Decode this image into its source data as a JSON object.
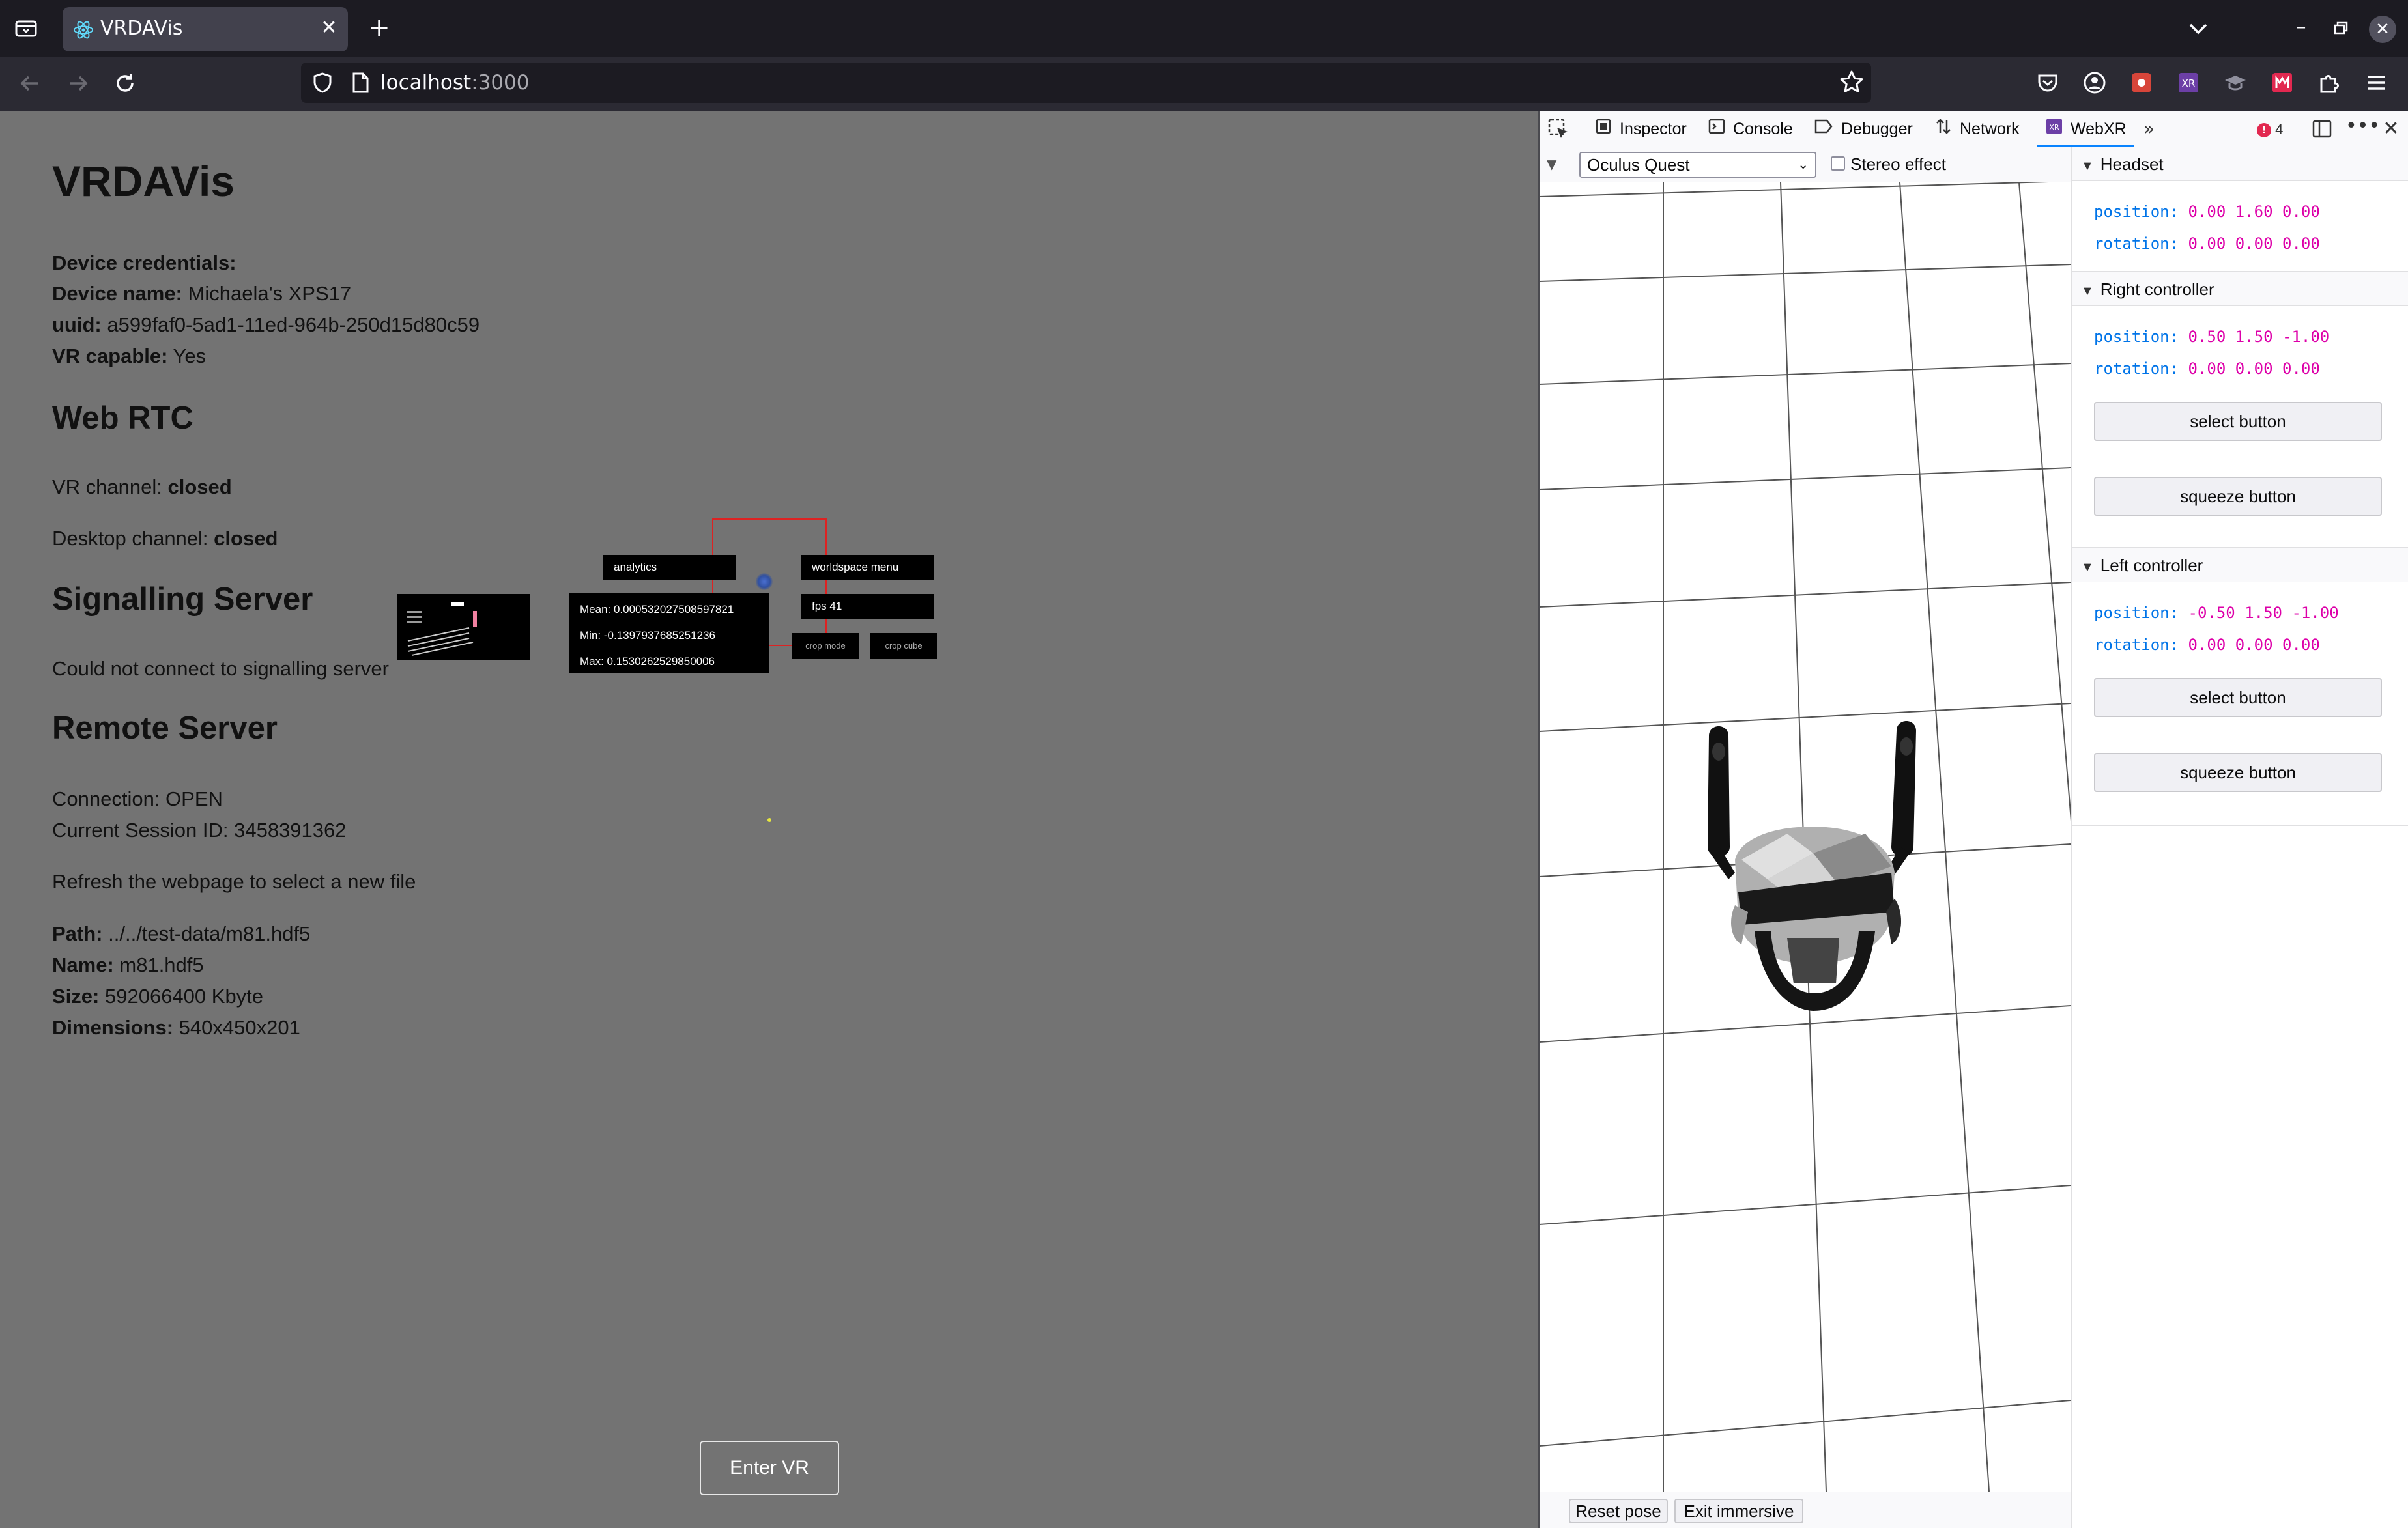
{
  "browser": {
    "tab_title": "VRDAVis",
    "url_host": "localhost",
    "url_port": ":3000"
  },
  "page": {
    "title": "VRDAVis",
    "device_credentials_label": "Device credentials:",
    "device_name_label": "Device name:",
    "device_name": "Michaela's XPS17",
    "uuid_label": "uuid:",
    "uuid": "a599faf0-5ad1-11ed-964b-250d15d80c59",
    "vr_capable_label": "VR capable:",
    "vr_capable": "Yes",
    "webrtc_heading": "Web RTC",
    "vr_channel_label": "VR channel:",
    "vr_channel": "closed",
    "desktop_channel_label": "Desktop channel:",
    "desktop_channel": "closed",
    "signalling_heading": "Signalling Server",
    "signalling_status": "Could not connect to signalling server",
    "remote_heading": "Remote Server",
    "connection": "Connection: OPEN",
    "session_id": "Current Session ID: 3458391362",
    "refresh_note": "Refresh the webpage to select a new file",
    "path_label": "Path:",
    "path": "../../test-data/m81.hdf5",
    "name_label": "Name:",
    "name": "m81.hdf5",
    "size_label": "Size:",
    "size": "592066400 Kbyte",
    "dimensions_label": "Dimensions:",
    "dimensions": "540x450x201",
    "enter_vr": "Enter VR"
  },
  "vr_scene": {
    "analytics_label": "analytics",
    "worldspace_menu_label": "worldspace menu",
    "mean": "Mean: 0.000532027508597821",
    "min": "Min: -0.1397937685251236",
    "max": "Max: 0.1530262529850006",
    "fps": "fps 41",
    "crop_mode": "crop mode",
    "crop_cube": "crop cube"
  },
  "devtools": {
    "tabs": [
      "Inspector",
      "Console",
      "Debugger",
      "Network",
      "WebXR"
    ],
    "error_count": "4",
    "device": "Oculus Quest",
    "stereo_label": "Stereo effect",
    "reset_pose": "Reset pose",
    "exit_immersive": "Exit immersive",
    "headset": {
      "title": "Headset",
      "position_label": "position:",
      "position": "0.00 1.60 0.00",
      "rotation_label": "rotation:",
      "rotation": "0.00 0.00 0.00"
    },
    "right_controller": {
      "title": "Right controller",
      "position_label": "position:",
      "position": "0.50 1.50 -1.00",
      "rotation_label": "rotation:",
      "rotation": "0.00 0.00 0.00",
      "select": "select button",
      "squeeze": "squeeze button"
    },
    "left_controller": {
      "title": "Left controller",
      "position_label": "position:",
      "position": "-0.50 1.50 -1.00",
      "rotation_label": "rotation:",
      "rotation": "0.00 0.00 0.00",
      "select": "select button",
      "squeeze": "squeeze button"
    }
  },
  "colors": {
    "page_bg": "#737373",
    "chrome_bg": "#1c1b22",
    "accent": "#0a84ff",
    "mono_key": "#0074e8",
    "mono_value": "#dd00a9"
  }
}
